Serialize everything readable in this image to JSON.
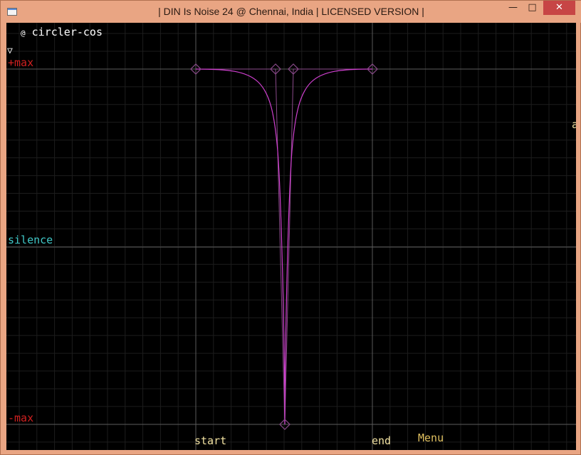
{
  "window": {
    "title": "| DIN Is Noise 24 @ Chennai, India | LICENSED VERSION |",
    "minimize_glyph": "—",
    "maximize_glyph": "□",
    "close_glyph": "✕"
  },
  "editor": {
    "curve_name_marker": "@",
    "curve_name": "circler-cos",
    "arrow_glyph": "▽",
    "labels": {
      "plus_max": "+max",
      "silence": "silence",
      "minus_max": "-max",
      "start": "start",
      "end": "end",
      "menu": "Menu",
      "edge_letter": "a"
    }
  },
  "colors": {
    "background": "#000000",
    "grid_minor": "#1d1d1d",
    "grid_major": "#5a5a5a",
    "curve": "#d040d0",
    "handle": "#8a4a8a",
    "curve_name": "#ffffff",
    "plus_max": "#d02020",
    "minus_max": "#d02020",
    "silence": "#40c8c8",
    "axis_label": "#f0e0a0",
    "menu": "#e0c060",
    "arrow": "#ffffff"
  }
}
